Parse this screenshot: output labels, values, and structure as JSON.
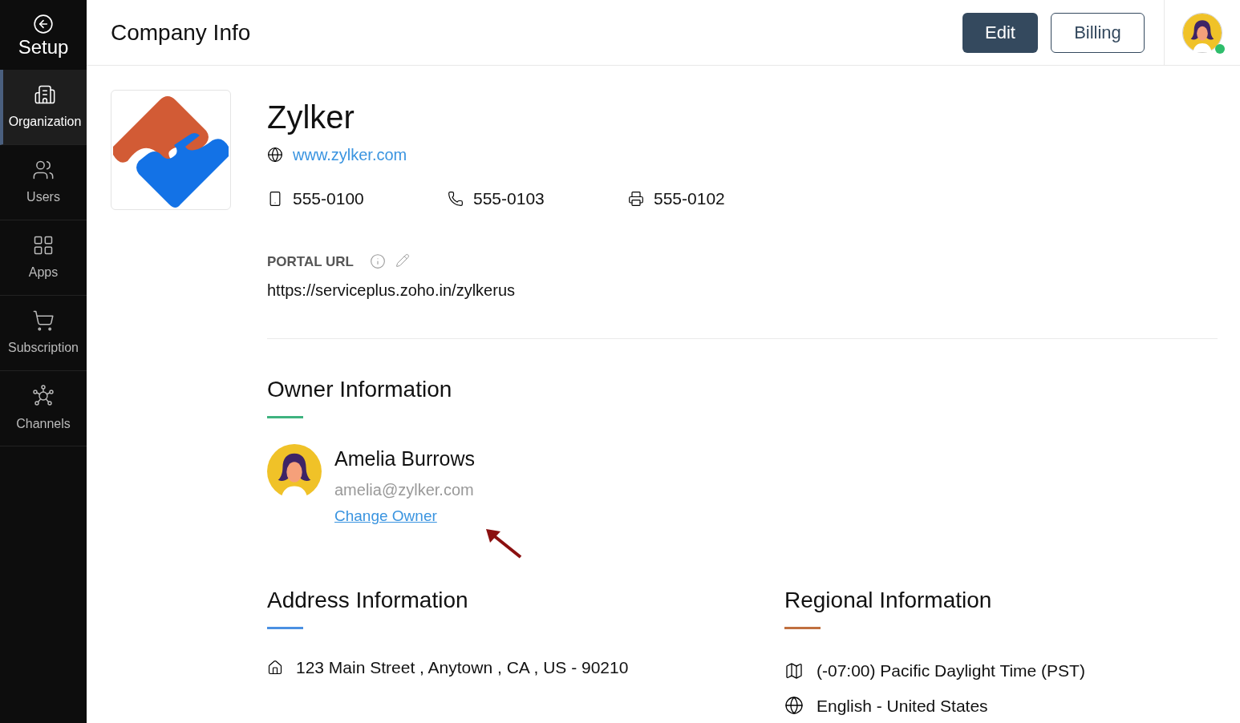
{
  "sidebar": {
    "title": "Setup",
    "items": [
      {
        "kind": "organization",
        "label": "Organization",
        "selected": true
      },
      {
        "kind": "users",
        "label": "Users",
        "selected": false
      },
      {
        "kind": "apps",
        "label": "Apps",
        "selected": false
      },
      {
        "kind": "subscription",
        "label": "Subscription",
        "selected": false
      },
      {
        "kind": "channels",
        "label": "Channels",
        "selected": false
      }
    ]
  },
  "header": {
    "title": "Company Info",
    "buttons": [
      {
        "label": "Edit",
        "kind": "primary"
      },
      {
        "label": "Billing",
        "kind": "outline"
      }
    ],
    "user_online": true
  },
  "company": {
    "name": "Zylker",
    "website": "www.zylker.com",
    "contacts": [
      {
        "kind": "mobile",
        "value": "555-0100"
      },
      {
        "kind": "phone",
        "value": "555-0103"
      },
      {
        "kind": "fax",
        "value": "555-0102"
      }
    ],
    "portal_url_label": "PORTAL URL",
    "portal_url": "https://serviceplus.zoho.in/zylkerus"
  },
  "owner": {
    "heading": "Owner Information",
    "color": "#3fb37f",
    "name": "Amelia Burrows",
    "email": "amelia@zylker.com",
    "link": "Change Owner"
  },
  "address": {
    "heading": "Address Information",
    "color": "#4a90e2",
    "lines": [
      "123 Main Street , Anytown , CA , US - 90210"
    ]
  },
  "regional": {
    "heading": "Regional Information",
    "color": "#c0703f",
    "items": [
      {
        "kind": "timezone",
        "value": "(-07:00) Pacific Daylight Time (PST)"
      },
      {
        "kind": "language",
        "value": "English - United States"
      }
    ]
  }
}
